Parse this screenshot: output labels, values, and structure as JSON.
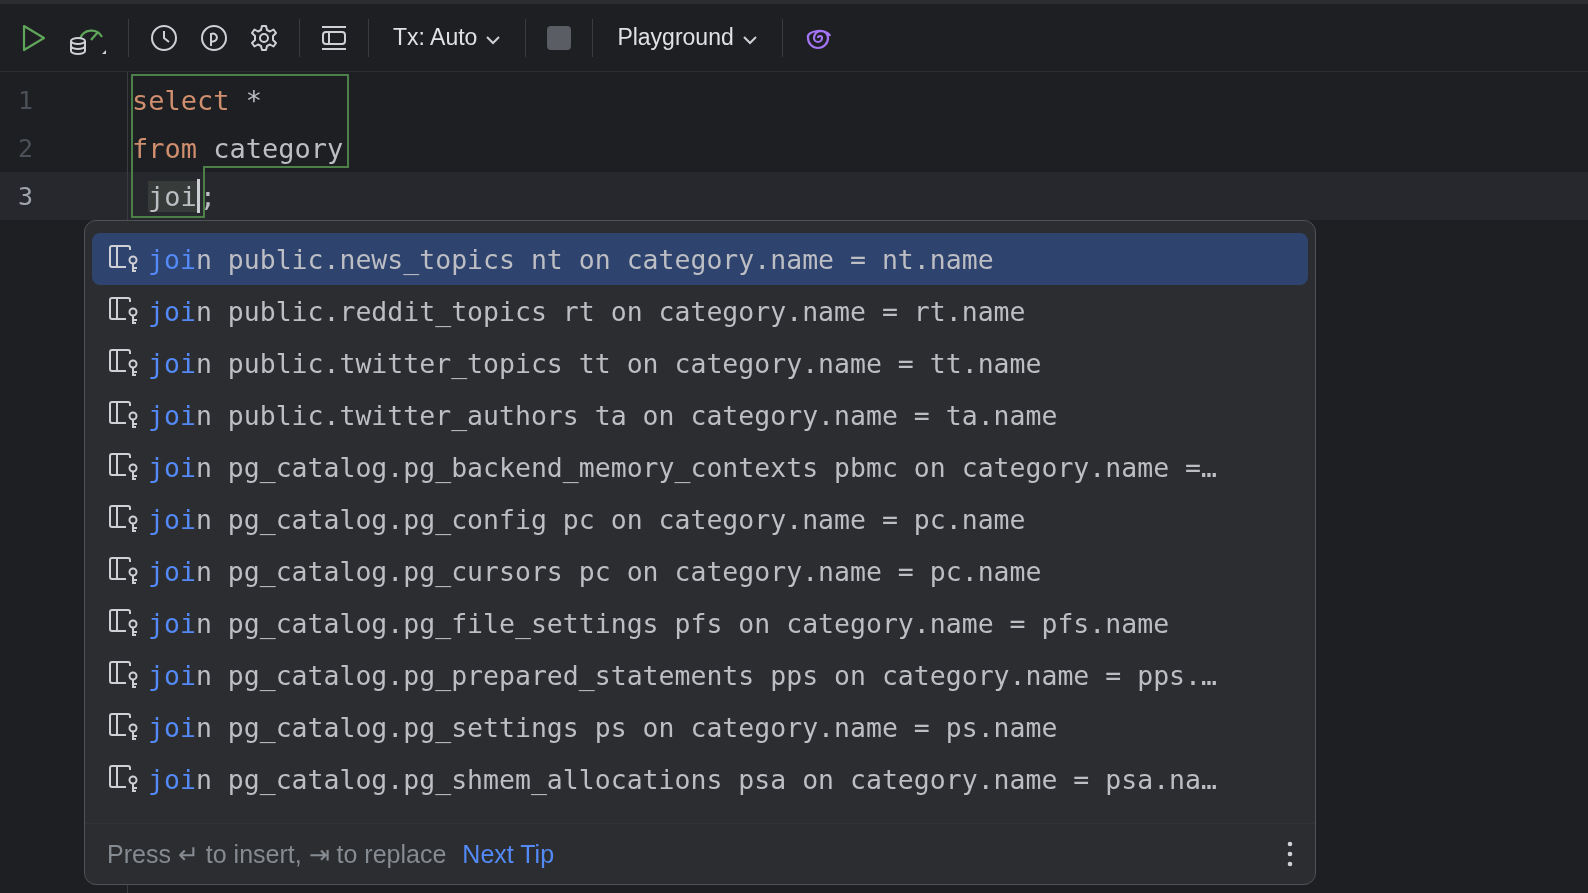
{
  "toolbar": {
    "transaction_mode": "Tx: Auto",
    "schema": "Playground"
  },
  "editor": {
    "lines": [
      {
        "number": "1",
        "current": false,
        "tokens": [
          {
            "kind": "keyword",
            "text": "select"
          },
          {
            "kind": "plain",
            "text": " *"
          }
        ]
      },
      {
        "number": "2",
        "current": false,
        "tokens": [
          {
            "kind": "keyword",
            "text": "from"
          },
          {
            "kind": "plain",
            "text": " category"
          }
        ]
      },
      {
        "number": "3",
        "current": true,
        "indented": true,
        "tokens": [
          {
            "kind": "typed",
            "text": "joi"
          },
          {
            "kind": "plain",
            "text": ";"
          }
        ]
      }
    ]
  },
  "completion": {
    "items": [
      {
        "matched": "joi",
        "rest": "n public.news_topics nt on category.name = nt.name",
        "selected": true
      },
      {
        "matched": "joi",
        "rest": "n public.reddit_topics rt on category.name = rt.name",
        "selected": false
      },
      {
        "matched": "joi",
        "rest": "n public.twitter_topics tt on category.name = tt.name",
        "selected": false
      },
      {
        "matched": "joi",
        "rest": "n public.twitter_authors ta on category.name = ta.name",
        "selected": false
      },
      {
        "matched": "joi",
        "rest": "n pg_catalog.pg_backend_memory_contexts pbmc on category.name =…",
        "selected": false
      },
      {
        "matched": "joi",
        "rest": "n pg_catalog.pg_config pc on category.name = pc.name",
        "selected": false
      },
      {
        "matched": "joi",
        "rest": "n pg_catalog.pg_cursors pc on category.name = pc.name",
        "selected": false
      },
      {
        "matched": "joi",
        "rest": "n pg_catalog.pg_file_settings pfs on category.name = pfs.name",
        "selected": false
      },
      {
        "matched": "joi",
        "rest": "n pg_catalog.pg_prepared_statements pps on category.name = pps.…",
        "selected": false
      },
      {
        "matched": "joi",
        "rest": "n pg_catalog.pg_settings ps on category.name = ps.name",
        "selected": false
      },
      {
        "matched": "joi",
        "rest": "n pg_catalog.pg_shmem_allocations psa on category.name = psa.na…",
        "selected": false
      }
    ],
    "hint": "Press ↵ to insert, ⇥ to replace",
    "next_tip": "Next Tip"
  }
}
